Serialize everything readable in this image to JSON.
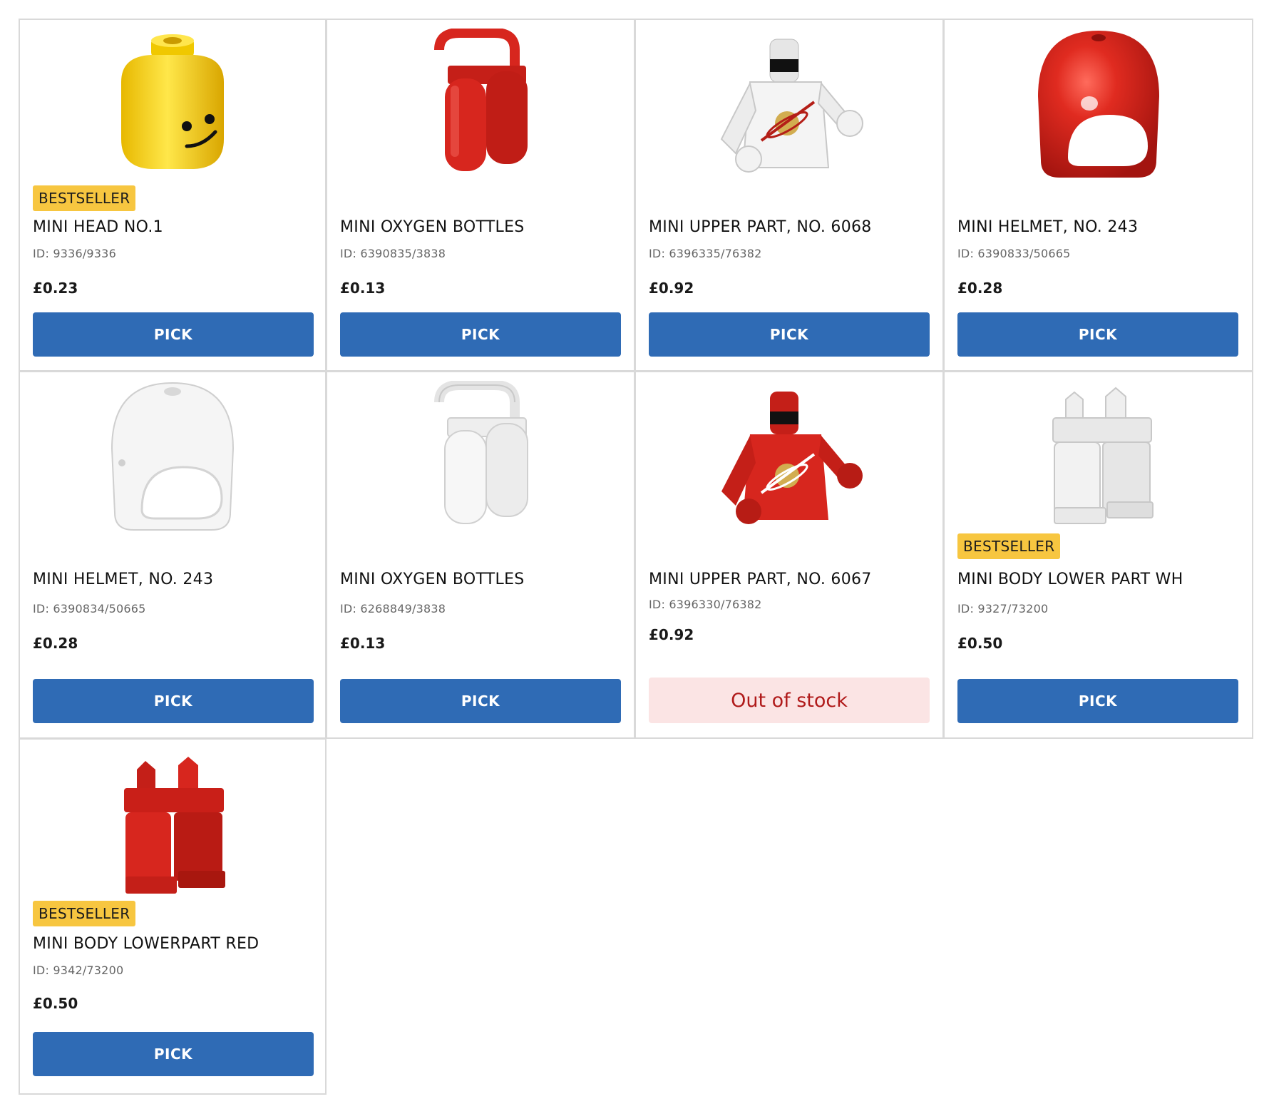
{
  "products": [
    {
      "badge": "BESTSELLER",
      "name": "MINI HEAD NO.1",
      "id": "ID: 9336/9336",
      "price": "£0.23",
      "action": "PICK",
      "image": "yellow-minifig-head-icon"
    },
    {
      "badge": "",
      "name": "MINI OXYGEN BOTTLES",
      "id": "ID: 6390835/3838",
      "price": "£0.13",
      "action": "PICK",
      "image": "red-oxygen-bottles-icon"
    },
    {
      "badge": "",
      "name": "MINI UPPER PART, NO. 6068",
      "id": "ID: 6396335/76382",
      "price": "£0.92",
      "action": "PICK",
      "image": "white-space-torso-icon"
    },
    {
      "badge": "",
      "name": "MINI HELMET, NO. 243",
      "id": "ID: 6390833/50665",
      "price": "£0.28",
      "action": "PICK",
      "image": "red-space-helmet-icon"
    },
    {
      "badge": "",
      "name": "MINI HELMET, NO. 243",
      "id": "ID: 6390834/50665",
      "price": "£0.28",
      "action": "PICK",
      "image": "white-space-helmet-icon"
    },
    {
      "badge": "",
      "name": "MINI OXYGEN BOTTLES",
      "id": "ID: 6268849/3838",
      "price": "£0.13",
      "action": "PICK",
      "image": "white-oxygen-bottles-icon"
    },
    {
      "badge": "",
      "name": "MINI UPPER PART, NO. 6067",
      "id": "ID: 6396330/76382",
      "price": "£0.92",
      "action": "Out of stock",
      "image": "red-space-torso-icon"
    },
    {
      "badge": "BESTSELLER",
      "name": "MINI BODY LOWER PART WH",
      "id": "ID: 9327/73200",
      "price": "£0.50",
      "action": "PICK",
      "image": "white-minifig-legs-icon"
    },
    {
      "badge": "BESTSELLER",
      "name": "MINI BODY LOWERPART RED",
      "id": "ID: 9342/73200",
      "price": "£0.50",
      "action": "PICK",
      "image": "red-minifig-legs-icon"
    }
  ],
  "colors": {
    "pick_button": "#2f6bb5",
    "badge": "#f7c640",
    "out_of_stock_bg": "#fbe4e4",
    "out_of_stock_text": "#b01a1a",
    "lego_red": "#d7261e",
    "lego_yellow": "#f5d21f",
    "lego_white": "#f2f2f2"
  }
}
